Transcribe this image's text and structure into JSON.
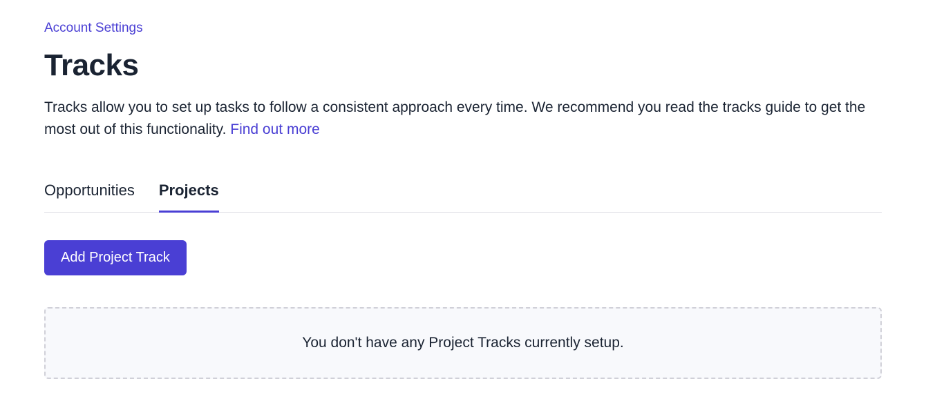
{
  "breadcrumb": {
    "label": "Account Settings"
  },
  "header": {
    "title": "Tracks",
    "description_prefix": "Tracks allow you to set up tasks to follow a consistent approach every time. We recommend you read the tracks guide to get the most out of this functionality. ",
    "link_text": "Find out more"
  },
  "tabs": {
    "items": [
      {
        "label": "Opportunities",
        "active": false
      },
      {
        "label": "Projects",
        "active": true
      }
    ]
  },
  "actions": {
    "add_button_label": "Add Project Track"
  },
  "empty_state": {
    "message": "You don't have any Project Tracks currently setup."
  }
}
